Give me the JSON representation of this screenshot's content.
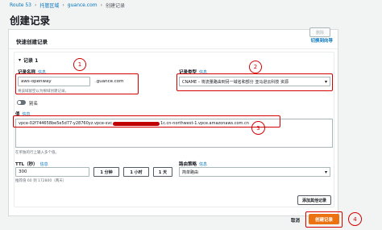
{
  "breadcrumb": {
    "items": [
      "Route 53",
      "托管区域",
      "guance.com",
      "创建记录"
    ]
  },
  "page": {
    "title": "创建记录"
  },
  "card": {
    "title": "快速创建记录",
    "switch_link": "切换到向导"
  },
  "record": {
    "header": "记录 1",
    "delete_label": "删除",
    "name": {
      "label": "记录名称",
      "info": "信息",
      "value": "aws-openway",
      "suffix": ".guance.com",
      "hint": "将该域留空以为根域创建记录。"
    },
    "type": {
      "label": "记录类型",
      "info": "信息",
      "value": "CNAME – 将流量路由到另一域名和部分 亚马逊云科技 资源"
    },
    "alias": {
      "label": "别名"
    },
    "value": {
      "label": "值",
      "info": "信息",
      "text_prefix": "vpce-02f744658be5e5d77-y28760yz.vpce-svc",
      "text_suffix": "1c.cn-northwest-1.vpce.amazonaws.com.cn",
      "hint": "在单独的行上输入多个值。"
    },
    "ttl": {
      "label": "TTL（秒）",
      "info": "信息",
      "value": "300",
      "hint": "推荐值 60 到 172800（两天）",
      "buttons": [
        "1 分钟",
        "1 小时",
        "1 天"
      ]
    },
    "routing": {
      "label": "路由策略",
      "info": "信息",
      "value": "简单路由"
    },
    "add_other_label": "添加其他记录"
  },
  "footer": {
    "cancel_label": "取消",
    "create_label": "创建记录"
  },
  "annotations": [
    "1",
    "2",
    "3",
    "4"
  ],
  "colors": {
    "accent": "#ec7211",
    "link": "#0073bb",
    "annotation": "#d40000"
  }
}
